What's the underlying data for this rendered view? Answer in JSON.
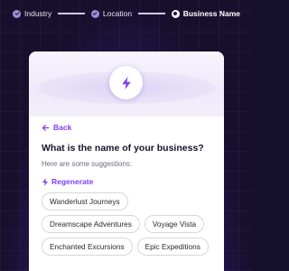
{
  "stepper": {
    "steps": [
      {
        "label": "Industry",
        "state": "done"
      },
      {
        "label": "Location",
        "state": "done"
      },
      {
        "label": "Business Name",
        "state": "current"
      }
    ]
  },
  "card": {
    "header_icon": "lightning-bolt-icon",
    "back_label": "Back",
    "question": "What is the name of your business?",
    "hint": "Here are some suggestions:",
    "regenerate_label": "Regenerate",
    "suggestions": [
      "Wanderlust Journeys",
      "Dreamscape Adventures",
      "Voyage Vista",
      "Enchanted Excursions",
      "Epic Expeditions"
    ]
  },
  "colors": {
    "accent": "#7b3ff2",
    "background": "#15102b",
    "card": "#ffffff"
  }
}
